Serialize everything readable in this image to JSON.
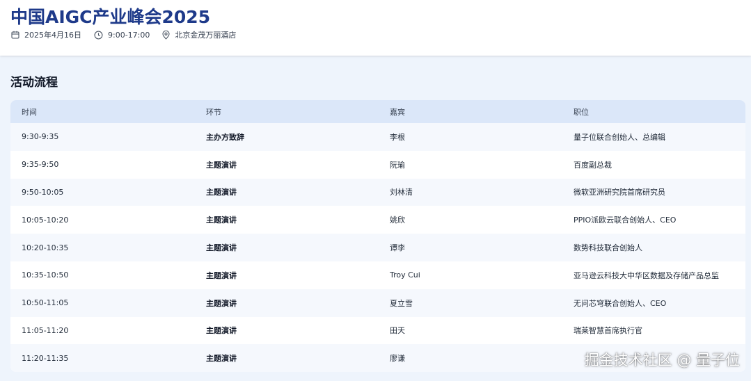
{
  "event": {
    "title": "中国AIGC产业峰会2025",
    "date": "2025年4月16日",
    "time": "9:00-17:00",
    "location": "北京金茂万丽酒店"
  },
  "icons": {
    "date": "calendar-icon",
    "time": "clock-icon",
    "location": "map-pin-icon"
  },
  "colors": {
    "title": "#1e3a8a",
    "header_row": "#dbe7f9",
    "background": "#eef4fc"
  },
  "agenda": {
    "section_title": "活动流程",
    "columns": [
      "时间",
      "环节",
      "嘉宾",
      "职位"
    ],
    "rows": [
      [
        "9:30-9:35",
        "主办方致辞",
        "李根",
        "量子位联合创始人、总编辑"
      ],
      [
        "9:35-9:50",
        "主题演讲",
        "阮瑜",
        "百度副总裁"
      ],
      [
        "9:50-10:05",
        "主题演讲",
        "刘林清",
        "微软亚洲研究院首席研究员"
      ],
      [
        "10:05-10:20",
        "主题演讲",
        "姚欣",
        "PPIO派欧云联合创始人、CEO"
      ],
      [
        "10:20-10:35",
        "主题演讲",
        "谭李",
        "数势科技联合创始人"
      ],
      [
        "10:35-10:50",
        "主题演讲",
        "Troy Cui",
        "亚马逊云科技大中华区数据及存储产品总监"
      ],
      [
        "10:50-11:05",
        "主题演讲",
        "夏立雪",
        "无问芯穹联合创始人、CEO"
      ],
      [
        "11:05-11:20",
        "主题演讲",
        "田天",
        "瑞莱智慧首席执行官"
      ],
      [
        "11:20-11:35",
        "主题演讲",
        "廖谦",
        ""
      ]
    ]
  },
  "watermark": "掘金技术社区 @ 量子位"
}
